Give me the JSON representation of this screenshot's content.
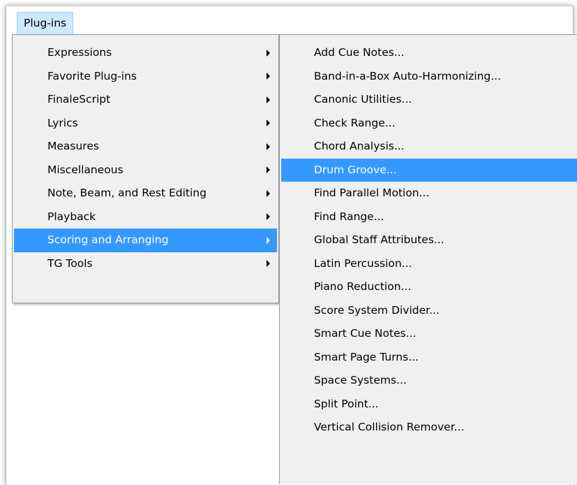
{
  "menubar": {
    "active_menu": "Plug-ins"
  },
  "plugins_menu": {
    "items": [
      {
        "label": "Expressions",
        "has_submenu": true,
        "icon": "chevron-right-icon"
      },
      {
        "label": "Favorite Plug-ins",
        "has_submenu": true,
        "icon": "chevron-right-icon"
      },
      {
        "label": "FinaleScript",
        "has_submenu": true,
        "icon": "chevron-right-icon"
      },
      {
        "label": "Lyrics",
        "has_submenu": true,
        "icon": "chevron-right-icon"
      },
      {
        "label": "Measures",
        "has_submenu": true,
        "icon": "chevron-right-icon"
      },
      {
        "label": "Miscellaneous",
        "has_submenu": true,
        "icon": "chevron-right-icon"
      },
      {
        "label": "Note, Beam, and Rest Editing",
        "has_submenu": true,
        "icon": "chevron-right-icon"
      },
      {
        "label": "Playback",
        "has_submenu": true,
        "icon": "chevron-right-icon"
      },
      {
        "label": "Scoring and Arranging",
        "has_submenu": true,
        "highlighted": true,
        "icon": "chevron-right-icon"
      },
      {
        "label": "TG Tools",
        "has_submenu": true,
        "icon": "chevron-right-icon"
      }
    ]
  },
  "scoring_submenu": {
    "items": [
      {
        "label": "Add Cue Notes..."
      },
      {
        "label": "Band-in-a-Box Auto-Harmonizing..."
      },
      {
        "label": "Canonic Utilities..."
      },
      {
        "label": "Check Range..."
      },
      {
        "label": "Chord Analysis..."
      },
      {
        "label": "Drum Groove...",
        "highlighted": true
      },
      {
        "label": "Find Parallel Motion..."
      },
      {
        "label": "Find Range..."
      },
      {
        "label": "Global Staff Attributes..."
      },
      {
        "label": "Latin Percussion..."
      },
      {
        "label": "Piano Reduction..."
      },
      {
        "label": "Score System Divider..."
      },
      {
        "label": "Smart Cue Notes..."
      },
      {
        "label": "Smart Page Turns..."
      },
      {
        "label": "Space Systems..."
      },
      {
        "label": "Split Point..."
      },
      {
        "label": "Vertical Collision Remover..."
      }
    ]
  },
  "colors": {
    "highlight": "#3399ff",
    "menu_background": "#f0f0f0",
    "menubar_active": "#cde8ff"
  }
}
